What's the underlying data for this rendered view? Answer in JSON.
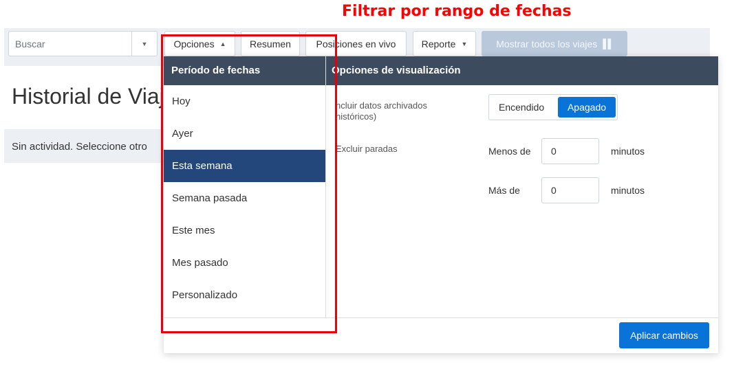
{
  "annotation": {
    "title": "Filtrar por rango de fechas",
    "color": "#ff0000"
  },
  "toolbar": {
    "search_placeholder": "Buscar",
    "options_label": "Opciones",
    "summary_label": "Resumen",
    "live_positions_label": "Posiciones en vivo",
    "report_label": "Reporte",
    "show_all_label": "Mostrar todos los viajes",
    "show_all_icon": "map-icon"
  },
  "page": {
    "title": "Historial de Viaj",
    "activity": "Sin actividad. Seleccione otro"
  },
  "panel": {
    "date_header": "Período de fechas",
    "options_header": "Opciones de visualización",
    "date_items": [
      "Hoy",
      "Ayer",
      "Esta semana",
      "Semana pasada",
      "Este mes",
      "Mes pasado",
      "Personalizado"
    ],
    "active_date": "Esta semana",
    "archived_label": "ncluir datos archivados\nhistóricos)",
    "archived_on": "Encendido",
    "archived_off": "Apagado",
    "archived_selected": "Apagado",
    "exclude_stops_label": "Excluir paradas",
    "less_than_label": "Menos de",
    "less_than_value": "0",
    "more_than_label": "Más de",
    "more_than_value": "0",
    "minutes_label": "minutos",
    "apply_label": "Aplicar cambios"
  },
  "colors": {
    "header": "#3c4b5e",
    "active": "#23467b",
    "primary": "#0a73d8",
    "highlight": "#e8000b"
  }
}
